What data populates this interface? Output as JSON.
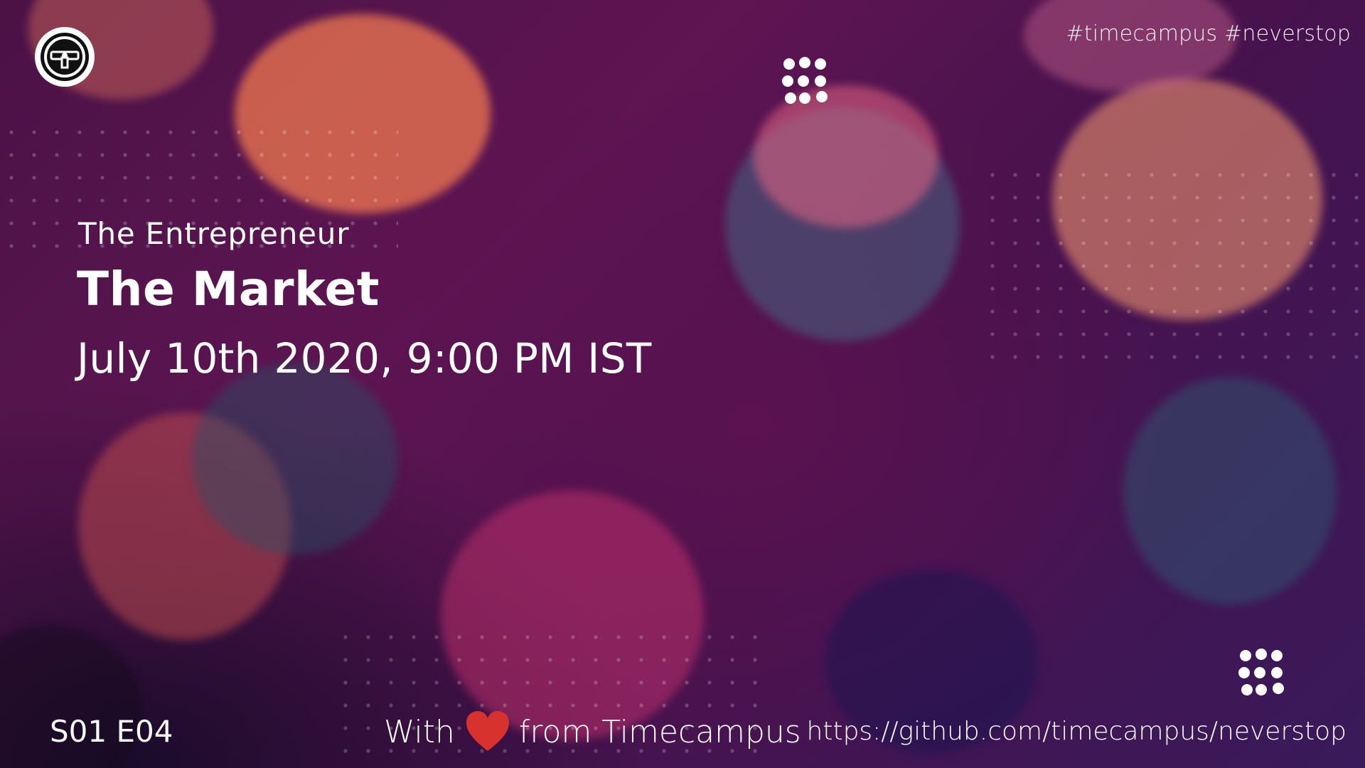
{
  "brand": {
    "logo_icon": "steering-wheel-logo-icon",
    "grid_icon": "dot-grid-icon"
  },
  "header": {
    "hashtags": "#timecampus #neverstop"
  },
  "main": {
    "series": "The Entrepreneur",
    "title": "The Market",
    "datetime": "July 10th 2020, 9:00 PM IST"
  },
  "footer": {
    "episode": "S01 E04",
    "credit_prefix": "With",
    "credit_icon": "heart-icon",
    "credit_suffix": "from Timecampus",
    "url": "https://github.com/timecampus/neverstop"
  },
  "colors": {
    "text": "#ffffff",
    "heart": "#d8322f",
    "background": "#4b1246"
  }
}
